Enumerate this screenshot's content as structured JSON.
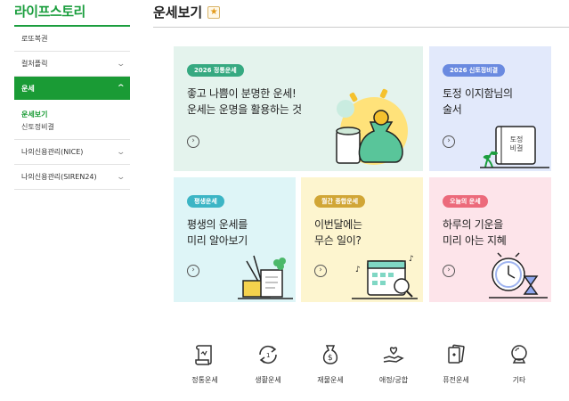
{
  "sidebar": {
    "brand": "라이프스토리",
    "items": [
      {
        "label": "로또복권"
      },
      {
        "label": "컬처플릭"
      },
      {
        "label": "운세"
      },
      {
        "label": "나의신용관리(NICE)"
      },
      {
        "label": "나의신용관리(SIREN24)"
      }
    ],
    "sub_items": [
      {
        "label": "운세보기"
      },
      {
        "label": "신토정비결"
      }
    ]
  },
  "header": {
    "title": "운세보기",
    "star_glyph": "★"
  },
  "cards": [
    {
      "badge": "2026 정통운세",
      "title": "좋고 나쁨이 분명한 운세!\n운세는 운명을 활용하는 것",
      "arrow": "›"
    },
    {
      "badge": "2026 신토정비결",
      "title": "토정 이지함님의\n술서",
      "arrow": "›",
      "book_text": "토정\n비결"
    },
    {
      "badge": "평생운세",
      "title": "평생의 운세를\n미리 알아보기",
      "arrow": "›"
    },
    {
      "badge": "월간 종합운세",
      "title": "이번달에는\n무슨 일이?",
      "arrow": "›"
    },
    {
      "badge": "오늘의 운세",
      "title": "하루의 기운을\n미리 아는 지혜",
      "arrow": "›"
    }
  ],
  "categories": [
    {
      "label": "정통운세",
      "icon": "scroll-icon"
    },
    {
      "label": "생활운세",
      "icon": "cycle-icon"
    },
    {
      "label": "재물운세",
      "icon": "money-bag-icon"
    },
    {
      "label": "애정/궁합",
      "icon": "heart-hand-icon"
    },
    {
      "label": "퓨전운세",
      "icon": "cards-icon"
    },
    {
      "label": "기타",
      "icon": "crystal-ball-icon"
    }
  ],
  "colors": {
    "brand_green": "#1b9e3e",
    "card1_bg": "#e4f3ed",
    "card2_bg": "#e2e9fb",
    "card3_bg": "#def5f7",
    "card4_bg": "#fdf5cf",
    "card5_bg": "#fde4ea"
  }
}
